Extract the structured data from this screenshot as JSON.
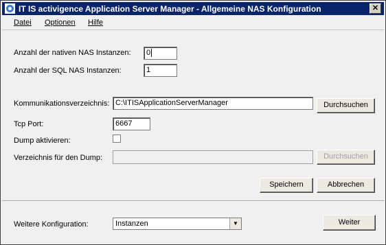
{
  "window": {
    "title": "IT IS activigence Application Server Manager - Allgemeine NAS Konfiguration",
    "close_label": "✕"
  },
  "menu": {
    "items": [
      {
        "label": "Datei"
      },
      {
        "label": "Optionen"
      },
      {
        "label": "Hilfe"
      }
    ]
  },
  "form": {
    "native_nas_label": "Anzahl der nativen NAS Instanzen:",
    "native_nas_value": "0",
    "sql_nas_label": "Anzahl der SQL NAS Instanzen:",
    "sql_nas_value": "1",
    "comm_dir_label": "Kommunikationsverzeichnis:",
    "comm_dir_value": "C:\\ITISApplicationServerManager",
    "browse_label": "Durchsuchen",
    "tcp_port_label": "Tcp Port:",
    "tcp_port_value": "6667",
    "dump_enable_label": "Dump aktivieren:",
    "dump_enabled": false,
    "dump_dir_label": "Verzeichnis für den Dump:",
    "dump_dir_value": "",
    "dump_browse_label": "Durchsuchen",
    "save_label": "Speichern",
    "cancel_label": "Abbrechen"
  },
  "footer": {
    "further_config_label": "Weitere Konfiguration:",
    "further_config_value": "Instanzen",
    "next_label": "Weiter"
  },
  "colors": {
    "titlebar": "#0a246a",
    "window_bg": "#f0f0f0"
  }
}
